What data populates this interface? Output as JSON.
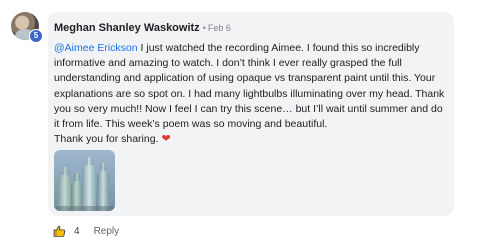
{
  "comment": {
    "author": "Meghan Shanley Waskowitz",
    "separator": "•",
    "date": "Feb 6",
    "level_badge": "5",
    "mention": "@Aimee Erickson",
    "body": " I just watched the recording Aimee. I found this so incredibly informative and amazing to watch. I don’t think I ever really grasped the full understanding and application of using opaque vs transparent paint until this. Your explanations are so spot on. I had many lightbulbs illuminating over my head. Thank you so very much!! Now I feel I can try this scene… but I’ll wait until summer and do it from life. This week’s poem was so moving and beautiful.",
    "closing": "Thank you for sharing.",
    "heart_emoji": "❤",
    "heart_color": "#e53935",
    "mention_color": "#1a73e8"
  },
  "actions": {
    "like_icon": "thumbs-up-icon",
    "like_count": "4",
    "reply_label": "Reply"
  }
}
